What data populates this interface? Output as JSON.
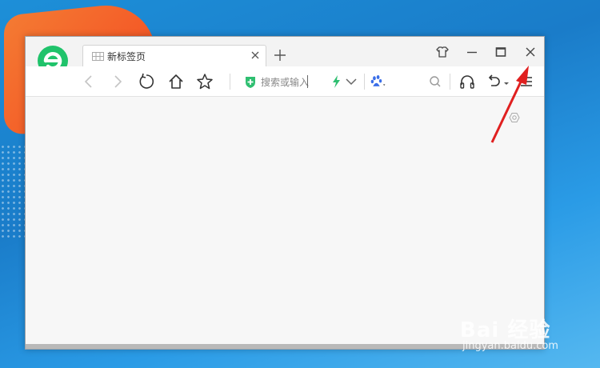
{
  "browser": {
    "tab": {
      "title": "新标签页",
      "icon": "grid-page-icon"
    },
    "window_controls": [
      "skin-tshirt-icon",
      "minimize-icon",
      "maximize-icon",
      "close-icon"
    ],
    "toolbar": {
      "nav": [
        "back-icon",
        "forward-icon",
        "refresh-icon",
        "home-icon",
        "star-icon"
      ],
      "search_placeholder": "搜索或输入网址",
      "search_value": "搜索或输入",
      "right_icons": [
        "search-icon",
        "headphones-icon",
        "undo-icon",
        "menu-icon"
      ]
    },
    "colors": {
      "accent_green": "#2fbf71",
      "logo_green": "#18c267",
      "arrow_red": "#e02020"
    }
  },
  "watermark": {
    "brand": "Bai 经验",
    "url": "jingyan.baidu.com"
  }
}
